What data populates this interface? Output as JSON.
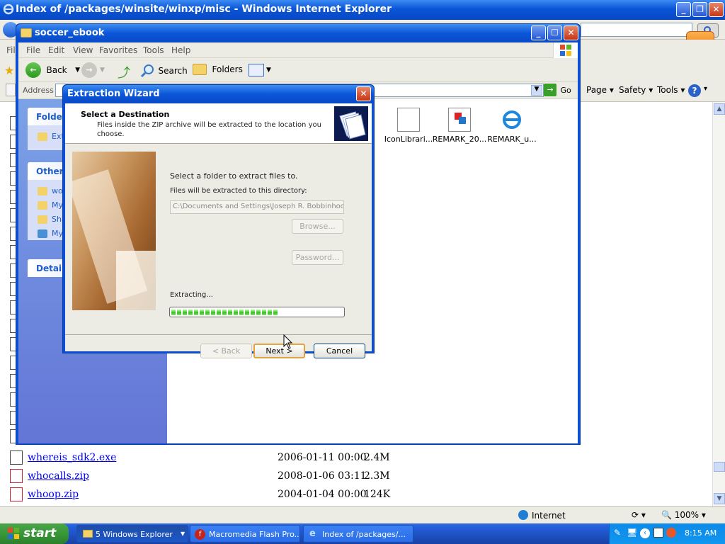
{
  "ie": {
    "title": "Index of /packages/winsite/winxp/misc - Windows Internet Explorer",
    "menu_file_partial": "Fil",
    "cmd": {
      "page": "Page",
      "safety": "Safety",
      "tools": "Tools"
    },
    "status": {
      "zone": "Internet",
      "zoom": "100%"
    },
    "files": [
      {
        "name": "whereis_sdk2.exe",
        "date": "2006-01-11 00:00",
        "size": "2.4M"
      },
      {
        "name": "whocalls.zip",
        "date": "2008-01-06 03:11",
        "size": "2.3M"
      },
      {
        "name": "whoop.zip",
        "date": "2004-01-04 00:00",
        "size": "124K"
      }
    ]
  },
  "explorer": {
    "title": "soccer_ebook",
    "menu": [
      "File",
      "Edit",
      "View",
      "Favorites",
      "Tools",
      "Help"
    ],
    "toolbar": {
      "back": "Back",
      "search": "Search",
      "folders": "Folders"
    },
    "address_label": "Address",
    "go": "Go",
    "panels": {
      "folder_tasks_partial": "Folder",
      "folder_item_partial": "Ext",
      "other_partial": "Other",
      "other_items": [
        "wo",
        "My",
        "Sha",
        "My"
      ],
      "details_partial": "Details"
    },
    "files": [
      "IconLibrari...",
      "REMARK_20...",
      "REMARK_u..."
    ]
  },
  "wizard": {
    "title": "Extraction Wizard",
    "heading": "Select a Destination",
    "subheading_line1": "Files inside the ZIP archive will be extracted to the location you",
    "subheading_line2": "choose.",
    "select_label": "Select a folder to extract files to.",
    "dir_label": "Files will be extracted to this directory:",
    "dir_value": "C:\\Documents and Settings\\Joseph R. Bobbinhood",
    "browse": "Browse...",
    "password": "Password...",
    "extracting": "Extracting...",
    "progress": 0.63,
    "back": "< Back",
    "next": "Next >",
    "cancel": "Cancel"
  },
  "taskbar": {
    "start": "start",
    "tasks": [
      "5 Windows Explorer",
      "Macromedia Flash Pro...",
      "Index of /packages/..."
    ],
    "clock": "8:15 AM"
  }
}
